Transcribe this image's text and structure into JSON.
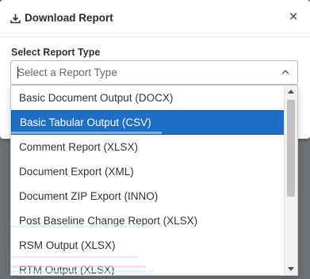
{
  "modal": {
    "title": "Download Report",
    "close_symbol": "×",
    "header_icon": "download-icon"
  },
  "form": {
    "label": "Select Report Type",
    "placeholder": "Select a Report Type",
    "value": ""
  },
  "dropdown": {
    "options": [
      {
        "label": "Basic Document Output (DOCX)",
        "highlighted": false
      },
      {
        "label": "Basic Tabular Output (CSV)",
        "highlighted": true
      },
      {
        "label": "Comment Report (XLSX)",
        "highlighted": false
      },
      {
        "label": "Document Export (XML)",
        "highlighted": false
      },
      {
        "label": "Document ZIP Export (INNO)",
        "highlighted": false
      },
      {
        "label": "Post Baseline Change Report (XLSX)",
        "highlighted": false
      },
      {
        "label": "RSM Output (XLSX)",
        "highlighted": false
      },
      {
        "label": "RTM Output (XLSX)",
        "highlighted": false
      }
    ]
  },
  "colors": {
    "highlight": "#1e6ec7",
    "overlay": "#6e7175",
    "text": "#333333"
  }
}
